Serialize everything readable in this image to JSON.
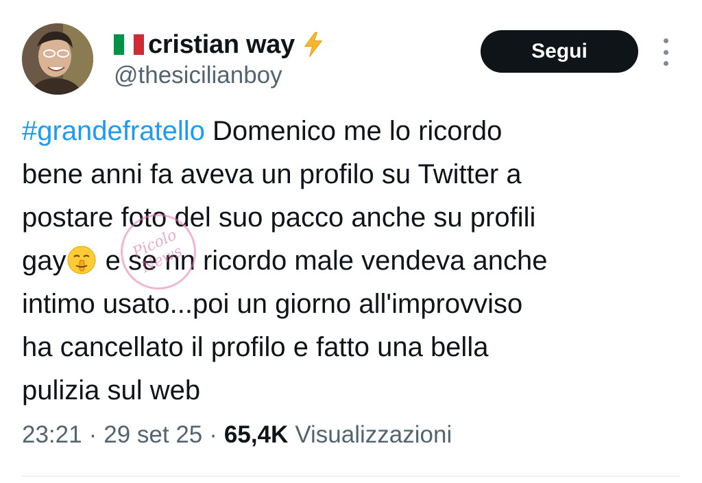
{
  "author": {
    "flag": "🇮🇹",
    "display_name": "cristian way",
    "handle": "@thesicilianboy",
    "badge_icon": "lightning-bolt-icon"
  },
  "actions": {
    "follow_label": "Segui",
    "more_icon": "more-vertical-icon"
  },
  "tweet": {
    "hashtag": "#grandefratello",
    "lines": [
      " Domenico me lo ricordo",
      "bene anni fa aveva un profilo su Twitter a",
      "postare foto del suo pacco anche su profili",
      "gay",
      " e se nn ricordo male vendeva anche",
      "intimo usato...poi un giorno all'improvviso",
      "ha  cancellato il profilo e fatto una bella",
      "pulizia sul web"
    ],
    "emoji": "shushing-face-icon"
  },
  "meta": {
    "time": "23:21",
    "date": "29 set 25",
    "separator": "·",
    "views_count": "65,4K",
    "views_label": "Visualizzazioni"
  },
  "watermark": {
    "line1": "Picolo",
    "line2": "News"
  },
  "colors": {
    "hashtag": "#1d9bf0",
    "button_bg": "#0f1419",
    "secondary_text": "#536471",
    "bolt": "#f7b731"
  }
}
